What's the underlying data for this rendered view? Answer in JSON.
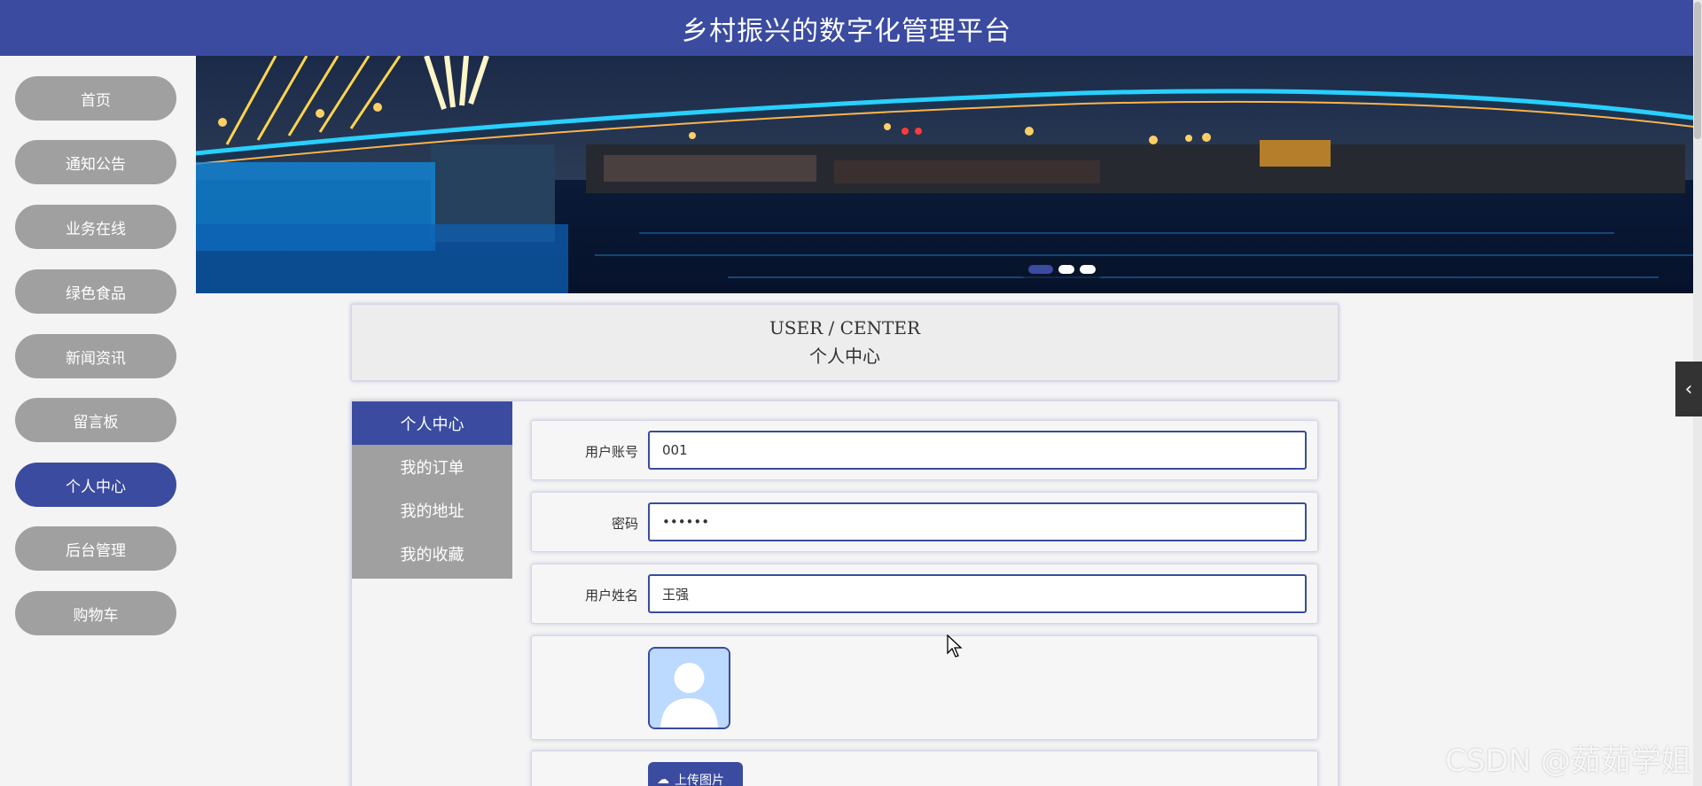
{
  "header": {
    "title": "乡村振兴的数字化管理平台"
  },
  "sidebar": {
    "items": [
      {
        "label": "首页",
        "active": false
      },
      {
        "label": "通知公告",
        "active": false
      },
      {
        "label": "业务在线",
        "active": false
      },
      {
        "label": "绿色食品",
        "active": false
      },
      {
        "label": "新闻资讯",
        "active": false
      },
      {
        "label": "留言板",
        "active": false
      },
      {
        "label": "个人中心",
        "active": true
      },
      {
        "label": "后台管理",
        "active": false
      },
      {
        "label": "购物车",
        "active": false
      }
    ]
  },
  "banner": {
    "slide_count": 3,
    "active_slide": 1
  },
  "user_center": {
    "title_en": "USER / CENTER",
    "title_cn": "个人中心"
  },
  "tabs": [
    {
      "label": "个人中心",
      "active": true
    },
    {
      "label": "我的订单",
      "active": false
    },
    {
      "label": "我的地址",
      "active": false
    },
    {
      "label": "我的收藏",
      "active": false
    }
  ],
  "form": {
    "account": {
      "label": "用户账号",
      "value": "001"
    },
    "password": {
      "label": "密码",
      "value": "••••••"
    },
    "name": {
      "label": "用户姓名",
      "value": "王强"
    },
    "upload_button": "上传图片"
  },
  "watermark": "CSDN @茹茹学姐",
  "colors": {
    "primary": "#3a4ba0",
    "nav_inactive": "#a0a0a0",
    "background": "#f4f4f4"
  },
  "icons": {
    "side_toggle": "chevron-left-icon",
    "avatar": "user-avatar-icon",
    "upload": "cloud-upload-icon"
  }
}
